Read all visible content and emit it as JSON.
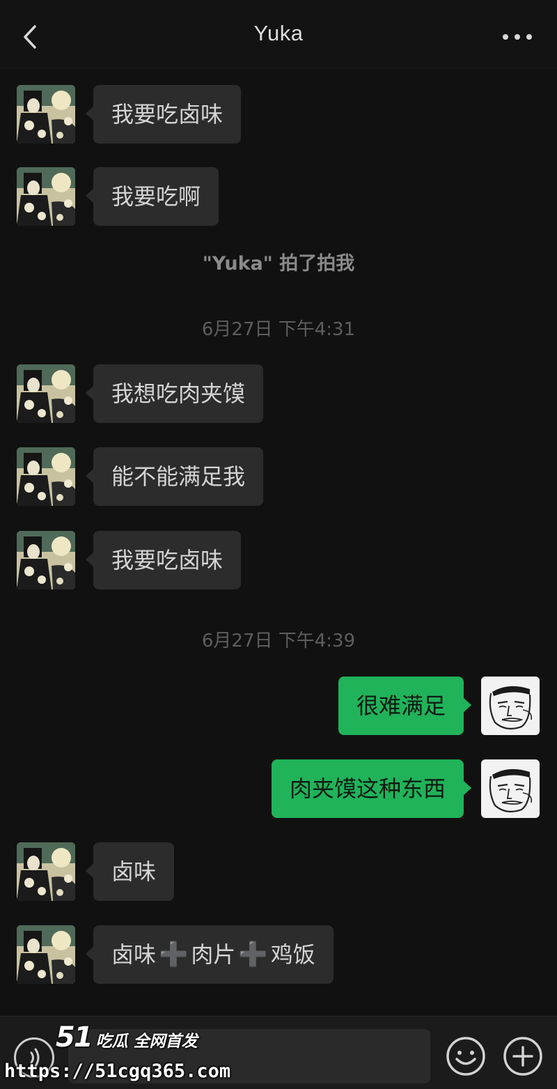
{
  "header": {
    "title": "Yuka",
    "back_icon": "chevron-left-icon",
    "more_icon": "more-dots-icon"
  },
  "messages": [
    {
      "side": "left",
      "text": "我要吃卤味"
    },
    {
      "side": "left",
      "text": "我要吃啊"
    },
    {
      "side": "left",
      "text": "我想吃肉夹馍"
    },
    {
      "side": "left",
      "text": "能不能满足我"
    },
    {
      "side": "left",
      "text": "我要吃卤味"
    },
    {
      "side": "right",
      "text": "很难满足"
    },
    {
      "side": "right",
      "text": "肉夹馍这种东西"
    },
    {
      "side": "left",
      "text": "卤味"
    },
    {
      "side": "left",
      "parts": [
        "卤味",
        "肉片",
        "鸡饭"
      ],
      "separator": "➕"
    }
  ],
  "system": {
    "pat_notice": "\"Yuka\" 拍了拍我",
    "time_1": "6月27日 下午4:31",
    "time_2": "6月27日 下午4:39"
  },
  "input_bar": {
    "voice_icon": "voice-icon",
    "emoji_icon": "emoji-icon",
    "add_icon": "plus-circle-icon",
    "placeholder": ""
  },
  "watermark": {
    "brand_number": "51",
    "brand_text": "吃瓜 全网首发",
    "url": "https://51cgq365.com"
  },
  "colors": {
    "background": "#111111",
    "incoming_bubble": "#2c2c2c",
    "outgoing_bubble": "#20b35a"
  }
}
